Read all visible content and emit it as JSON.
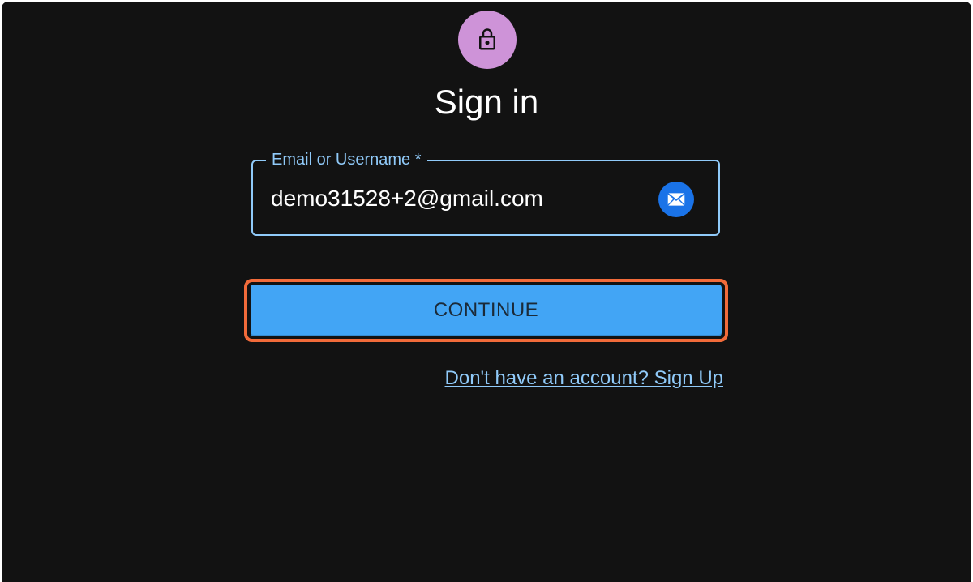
{
  "avatar": {
    "icon": "lock-icon",
    "color": "#ce93d8"
  },
  "title": "Sign in",
  "email_field": {
    "label": "Email or Username *",
    "value": "demo31528+2@gmail.com",
    "icon": "mail-icon"
  },
  "continue_button": {
    "label": "CONTINUE",
    "color": "#42a5f5",
    "highlight_color": "#f26b3a"
  },
  "signup_link": {
    "label": "Don't have an account? Sign Up"
  }
}
